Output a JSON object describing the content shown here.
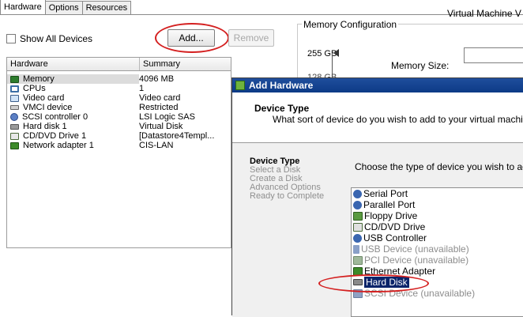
{
  "tabs": [
    "Hardware",
    "Options",
    "Resources"
  ],
  "show_all_devices": "Show All Devices",
  "add_button": "Add...",
  "remove_button": "Remove",
  "table": {
    "headers": [
      "Hardware",
      "Summary"
    ],
    "rows": [
      {
        "name": "Memory",
        "summary": "4096 MB",
        "icon": "memory-icon"
      },
      {
        "name": "CPUs",
        "summary": "1",
        "icon": "cpu-icon"
      },
      {
        "name": "Video card",
        "summary": "Video card",
        "icon": "video-card-icon"
      },
      {
        "name": "VMCI device",
        "summary": "Restricted",
        "icon": "vmci-device-icon"
      },
      {
        "name": "SCSI controller 0",
        "summary": "LSI Logic SAS",
        "icon": "scsi-controller-icon"
      },
      {
        "name": "Hard disk 1",
        "summary": "Virtual Disk",
        "icon": "hard-disk-icon"
      },
      {
        "name": "CD/DVD Drive 1",
        "summary": "[Datastore4Templ...",
        "icon": "cd-dvd-icon"
      },
      {
        "name": "Network adapter 1",
        "summary": "CIS-LAN",
        "icon": "network-adapter-icon"
      }
    ]
  },
  "memory": {
    "group_label": "Memory Configuration",
    "vm_version_text": "Virtual Machine V",
    "max_label": "255 GB",
    "size_label": "Memory Size:",
    "partial_label": "128 GB"
  },
  "dialog": {
    "title": "Add Hardware",
    "header_title": "Device Type",
    "header_subtitle": "What sort of device do you wish to add to your virtual machin",
    "steps": [
      "Device Type",
      "Select a Disk",
      "Create a Disk",
      "Advanced Options",
      "Ready to Complete"
    ],
    "choose_text": "Choose the type of device you wish to ad",
    "devices": [
      {
        "label": "Serial Port",
        "enabled": true,
        "icon": "serial-port-icon"
      },
      {
        "label": "Parallel Port",
        "enabled": true,
        "icon": "parallel-port-icon"
      },
      {
        "label": "Floppy Drive",
        "enabled": true,
        "icon": "floppy-drive-icon"
      },
      {
        "label": "CD/DVD Drive",
        "enabled": true,
        "icon": "cd-dvd-drive-icon"
      },
      {
        "label": "USB Controller",
        "enabled": true,
        "icon": "usb-controller-icon"
      },
      {
        "label": "USB Device (unavailable)",
        "enabled": false,
        "icon": "usb-device-icon"
      },
      {
        "label": "PCI Device (unavailable)",
        "enabled": false,
        "icon": "pci-device-icon"
      },
      {
        "label": "Ethernet Adapter",
        "enabled": true,
        "icon": "ethernet-adapter-icon"
      },
      {
        "label": "Hard Disk",
        "enabled": true,
        "icon": "hard-disk-icon",
        "selected": true
      },
      {
        "label": "SCSI Device (unavailable)",
        "enabled": false,
        "icon": "scsi-device-icon"
      }
    ]
  },
  "colors": {
    "annotation": "#d42020",
    "title_bar": "#0d3a86",
    "selection": "#0a246a"
  }
}
